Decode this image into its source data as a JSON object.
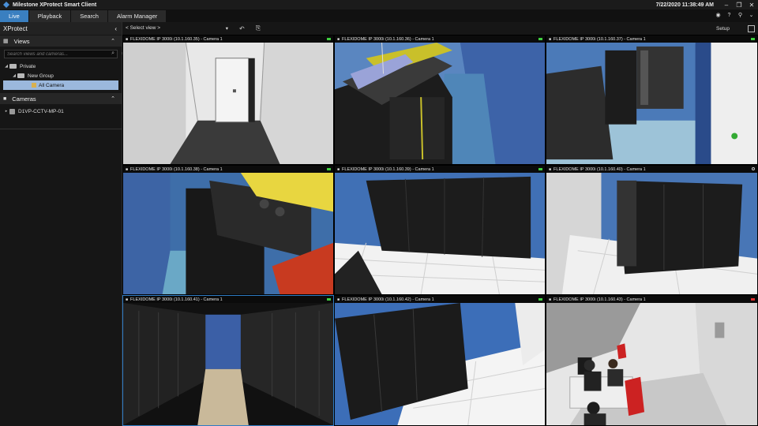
{
  "window": {
    "title": "Milestone XProtect Smart Client",
    "datetime": "7/22/2020 11:38:49 AM"
  },
  "tabs": [
    {
      "label": "Live",
      "active": true
    },
    {
      "label": "Playback",
      "active": false
    },
    {
      "label": "Search",
      "active": false
    },
    {
      "label": "Alarm Manager",
      "active": false
    }
  ],
  "sidebar": {
    "header": "XProtect",
    "views_label": "Views",
    "search_placeholder": "Search views and cameras...",
    "tree": {
      "private": "Private",
      "group": "New Group",
      "view": "All Camera"
    },
    "cameras_label": "Cameras",
    "server": "D1VP-CCTV-MP-01"
  },
  "toolbar": {
    "select_view": "< Select view >",
    "setup": "Setup"
  },
  "cameras": [
    {
      "label": "FLEXIDOME IP 3000i (10.1.160.35) - Camera 1",
      "status": "green"
    },
    {
      "label": "FLEXIDOME IP 3000i (10.1.160.36) - Camera 1",
      "status": "green"
    },
    {
      "label": "FLEXIDOME IP 3000i (10.1.160.37) - Camera 1",
      "status": "green"
    },
    {
      "label": "FLEXIDOME IP 3000i (10.1.160.38) - Camera 1",
      "status": "green"
    },
    {
      "label": "FLEXIDOME IP 3000i (10.1.160.39) - Camera 1",
      "status": "green"
    },
    {
      "label": "FLEXIDOME IP 3000i (10.1.160.40) - Camera 1",
      "status": "hollow"
    },
    {
      "label": "FLEXIDOME IP 3000i (10.1.160.41) - Camera 1",
      "status": "green"
    },
    {
      "label": "FLEXIDOME IP 3000i (10.1.160.42) - Camera 1",
      "status": "green"
    },
    {
      "label": "FLEXIDOME IP 3000i (10.1.160.43) - Camera 1",
      "status": "red"
    }
  ],
  "colors": {
    "accent": "#3a7fc0",
    "status_ok": "#3fcf3f",
    "status_alert": "#e23030"
  }
}
